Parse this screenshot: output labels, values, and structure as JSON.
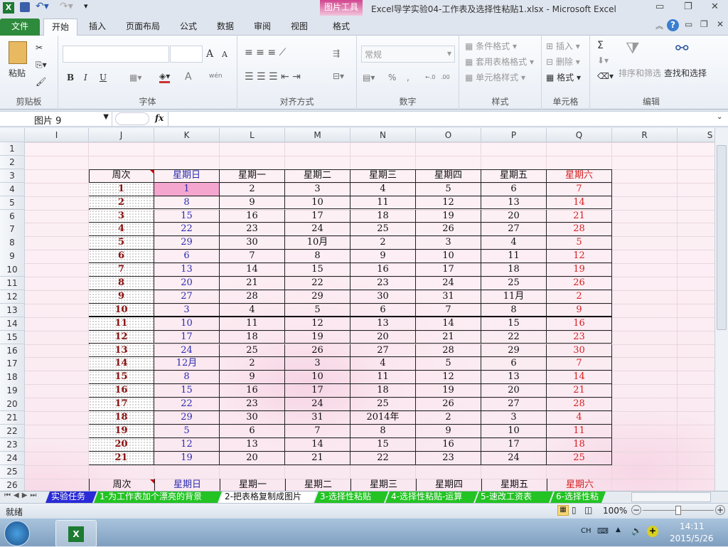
{
  "window": {
    "title": "Excel导学实验04-工作表及选择性粘贴1.xlsx  -  Microsoft Excel",
    "context_tab_group": "图片工具"
  },
  "ribbon_tabs": [
    {
      "label": "文件"
    },
    {
      "label": "开始"
    },
    {
      "label": "插入"
    },
    {
      "label": "页面布局"
    },
    {
      "label": "公式"
    },
    {
      "label": "数据"
    },
    {
      "label": "审阅"
    },
    {
      "label": "视图"
    },
    {
      "label": "格式"
    }
  ],
  "ribbon": {
    "clipboard": {
      "label": "剪贴板",
      "paste": "粘贴"
    },
    "font": {
      "label": "字体",
      "bold": "B",
      "italic": "I",
      "underline": "U",
      "grow": "A",
      "shrink": "A",
      "font_color": "A",
      "phonetic": "wén"
    },
    "alignment": {
      "label": "对齐方式"
    },
    "number": {
      "label": "数字",
      "format": "常规",
      "percent": "%",
      "comma": ",",
      "inc_decimal": "←.0",
      "dec_decimal": ".00"
    },
    "styles": {
      "label": "样式",
      "conditional": "条件格式",
      "table_format": "套用表格格式",
      "cell_styles": "单元格样式"
    },
    "cells": {
      "label": "单元格",
      "insert": "插入",
      "delete": "删除",
      "format": "格式"
    },
    "editing": {
      "label": "编辑",
      "sum": "Σ",
      "sort_filter": "排序和筛选",
      "find_select": "查找和选择"
    }
  },
  "formula_bar": {
    "name_box": "图片  9",
    "fx": "fx",
    "value": ""
  },
  "columns": [
    "I",
    "J",
    "K",
    "L",
    "M",
    "N",
    "O",
    "P",
    "Q",
    "R",
    "S"
  ],
  "row_numbers": [
    "1",
    "2",
    "3",
    "4",
    "5",
    "6",
    "7",
    "8",
    "9",
    "10",
    "11",
    "12",
    "13",
    "14",
    "15",
    "16",
    "17",
    "18",
    "19",
    "20",
    "21",
    "22",
    "23",
    "24",
    "25",
    "26"
  ],
  "table": {
    "headers": [
      "周次",
      "星期日",
      "星期一",
      "星期二",
      "星期三",
      "星期四",
      "星期五",
      "星期六"
    ],
    "rows": [
      [
        "1",
        "1",
        "2",
        "3",
        "4",
        "5",
        "6",
        "7"
      ],
      [
        "2",
        "8",
        "9",
        "10",
        "11",
        "12",
        "13",
        "14"
      ],
      [
        "3",
        "15",
        "16",
        "17",
        "18",
        "19",
        "20",
        "21"
      ],
      [
        "4",
        "22",
        "23",
        "24",
        "25",
        "26",
        "27",
        "28"
      ],
      [
        "5",
        "29",
        "30",
        "10月",
        "2",
        "3",
        "4",
        "5"
      ],
      [
        "6",
        "6",
        "7",
        "8",
        "9",
        "10",
        "11",
        "12"
      ],
      [
        "7",
        "13",
        "14",
        "15",
        "16",
        "17",
        "18",
        "19"
      ],
      [
        "8",
        "20",
        "21",
        "22",
        "23",
        "24",
        "25",
        "26"
      ],
      [
        "9",
        "27",
        "28",
        "29",
        "30",
        "31",
        "11月",
        "2"
      ],
      [
        "10",
        "3",
        "4",
        "5",
        "6",
        "7",
        "8",
        "9"
      ],
      [
        "11",
        "10",
        "11",
        "12",
        "13",
        "14",
        "15",
        "16"
      ],
      [
        "12",
        "17",
        "18",
        "19",
        "20",
        "21",
        "22",
        "23"
      ],
      [
        "13",
        "24",
        "25",
        "26",
        "27",
        "28",
        "29",
        "30"
      ],
      [
        "14",
        "12月",
        "2",
        "3",
        "4",
        "5",
        "6",
        "7"
      ],
      [
        "15",
        "8",
        "9",
        "10",
        "11",
        "12",
        "13",
        "14"
      ],
      [
        "16",
        "15",
        "16",
        "17",
        "18",
        "19",
        "20",
        "21"
      ],
      [
        "17",
        "22",
        "23",
        "24",
        "25",
        "26",
        "27",
        "28"
      ],
      [
        "18",
        "29",
        "30",
        "31",
        "2014年",
        "2",
        "3",
        "4"
      ],
      [
        "19",
        "5",
        "6",
        "7",
        "8",
        "9",
        "10",
        "11"
      ],
      [
        "20",
        "12",
        "13",
        "14",
        "15",
        "16",
        "17",
        "18"
      ],
      [
        "21",
        "19",
        "20",
        "21",
        "22",
        "23",
        "24",
        "25"
      ]
    ],
    "colors": {
      "sunday": "#2b2bb0",
      "saturday": "#d42020",
      "week": "#8b1010",
      "highlight": "#f4a6cf"
    }
  },
  "sheet_tabs": [
    {
      "label": "实验任务",
      "color": "#2a2ad6"
    },
    {
      "label": "1-为工作表加个漂亮的背景",
      "color": "#22c322"
    },
    {
      "label": "2-把表格复制成图片",
      "color": "#ffffff"
    },
    {
      "label": "3-选择性粘贴",
      "color": "#22c322"
    },
    {
      "label": "4-选择性粘贴-运算",
      "color": "#22c322"
    },
    {
      "label": "5-速改工资表",
      "color": "#22c322"
    },
    {
      "label": "6-选择性粘",
      "color": "#22c322"
    }
  ],
  "status": {
    "ready": "就绪",
    "zoom": "100%"
  },
  "taskbar": {
    "lang": "CH",
    "time": "14:11",
    "date": "2015/5/26"
  }
}
